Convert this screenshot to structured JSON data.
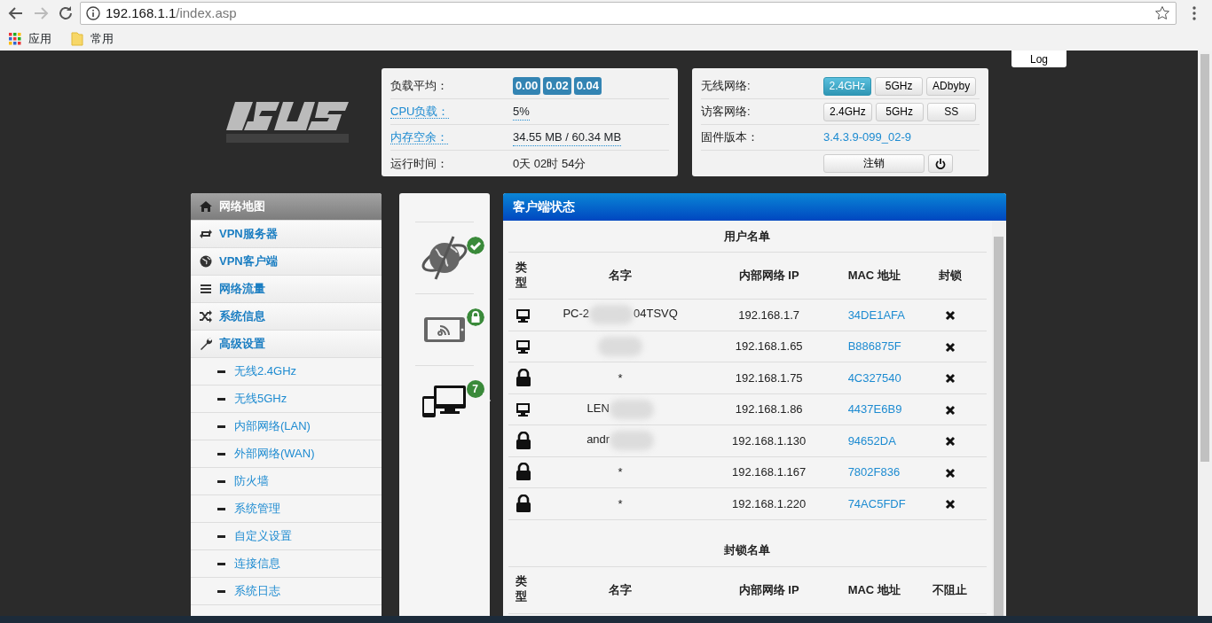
{
  "browser": {
    "url_host": "192.168.1.1",
    "url_path": "/index.asp",
    "bookmarks": [
      {
        "kind": "apps",
        "label": "应用"
      },
      {
        "kind": "folder",
        "label": "常用"
      }
    ]
  },
  "log_button": "Log",
  "system_status": {
    "load": {
      "label": "负载平均：",
      "values": [
        "0.00",
        "0.02",
        "0.04"
      ]
    },
    "cpu": {
      "label": "CPU负载：",
      "value": "5%"
    },
    "memory": {
      "label": "内存空余：",
      "value": "34.55 MB / 60.34 MB"
    },
    "uptime": {
      "label": "运行时间：",
      "value": "0天 02时 54分"
    }
  },
  "network_status": {
    "rows": [
      {
        "label": "无线网络:",
        "buttons": [
          {
            "label": "2.4GHz",
            "selected": true
          },
          {
            "label": "5GHz",
            "selected": false
          },
          {
            "label": "ADbyby",
            "selected": false
          }
        ]
      },
      {
        "label": "访客网络:",
        "buttons": [
          {
            "label": "2.4GHz",
            "selected": false
          },
          {
            "label": "5GHz",
            "selected": false
          },
          {
            "label": "SS",
            "selected": false
          }
        ]
      }
    ],
    "firmware": {
      "label": "固件版本：",
      "value": "3.4.3.9-099_02-9"
    },
    "logout": "注销"
  },
  "sidebar": {
    "items": [
      {
        "kind": "home",
        "label": "网络地图",
        "selected": true
      },
      {
        "kind": "swap",
        "label": "VPN服务器",
        "selected": false
      },
      {
        "kind": "globe",
        "label": "VPN客户端",
        "selected": false
      },
      {
        "kind": "list",
        "label": "网络流量",
        "selected": false
      },
      {
        "kind": "shuffle",
        "label": "系统信息",
        "selected": false
      },
      {
        "kind": "wrench",
        "label": "高级设置",
        "selected": false,
        "children": [
          {
            "label": "无线2.4GHz"
          },
          {
            "label": "无线5GHz"
          },
          {
            "label": "内部网络(LAN)"
          },
          {
            "label": "外部网络(WAN)"
          },
          {
            "label": "防火墙"
          },
          {
            "label": "系统管理"
          },
          {
            "label": "自定义设置"
          },
          {
            "label": "连接信息"
          },
          {
            "label": "系统日志"
          }
        ]
      }
    ]
  },
  "network_map": [
    {
      "kind": "internet",
      "badge": {
        "kind": "check"
      },
      "selected": false
    },
    {
      "kind": "router",
      "badge": {
        "kind": "lock"
      },
      "selected": false
    },
    {
      "kind": "clients",
      "badge": {
        "kind": "count",
        "text": "7"
      },
      "selected": true
    }
  ],
  "client_status": {
    "title": "客户端状态",
    "online": {
      "title": "用户名单",
      "columns": [
        "类型",
        "名字",
        "内部网络 IP",
        "MAC 地址",
        "封锁"
      ],
      "rows": [
        {
          "kind": "pc",
          "name": "PC-2",
          "name_tail": "04TSVQ",
          "blurred": true,
          "ip": "192.168.1.7",
          "mac": "34DE1AFA"
        },
        {
          "kind": "pc",
          "blurred": true,
          "ip": "192.168.1.65",
          "mac": "B886875F"
        },
        {
          "kind": "lock",
          "name": "*",
          "blurred": false,
          "ip": "192.168.1.75",
          "mac": "4C327540"
        },
        {
          "kind": "pc",
          "name": "LEN",
          "blurred": true,
          "ip": "192.168.1.86",
          "mac": "4437E6B9"
        },
        {
          "kind": "lock",
          "name": "andr",
          "blurred": true,
          "ip": "192.168.1.130",
          "mac": "94652DA"
        },
        {
          "kind": "lock",
          "name": "*",
          "blurred": false,
          "ip": "192.168.1.167",
          "mac": "7802F836"
        },
        {
          "kind": "lock",
          "name": "*",
          "blurred": false,
          "ip": "192.168.1.220",
          "mac": "74AC5FDF"
        }
      ]
    },
    "blocked": {
      "title": "封锁名单",
      "columns": [
        "类型",
        "名字",
        "内部网络 IP",
        "MAC 地址",
        "不阻止"
      ]
    }
  }
}
